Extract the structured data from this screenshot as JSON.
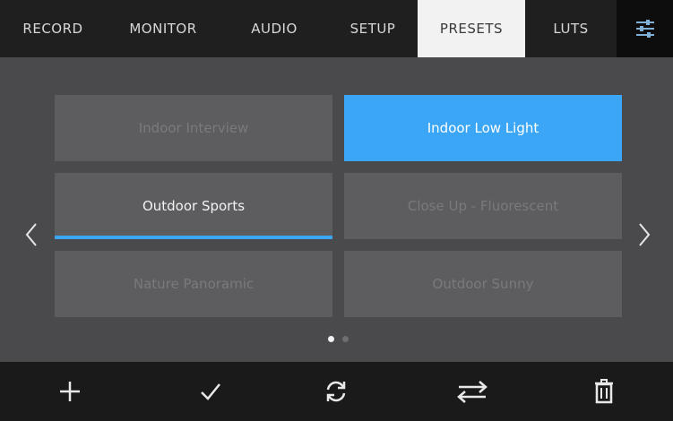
{
  "tabs": [
    {
      "label": "RECORD"
    },
    {
      "label": "MONITOR"
    },
    {
      "label": "AUDIO"
    },
    {
      "label": "SETUP"
    },
    {
      "label": "PRESETS"
    },
    {
      "label": "LUTS"
    }
  ],
  "active_tab": "PRESETS",
  "presets": [
    {
      "label": "Indoor Interview",
      "state": "inactive"
    },
    {
      "label": "Indoor Low Light",
      "state": "selected"
    },
    {
      "label": "Outdoor Sports",
      "state": "loaded"
    },
    {
      "label": "Close Up - Fluorescent",
      "state": "inactive"
    },
    {
      "label": "Nature Panoramic",
      "state": "inactive"
    },
    {
      "label": "Outdoor Sunny",
      "state": "inactive"
    }
  ],
  "pagination": {
    "current_page": 1,
    "total_pages": 2
  },
  "toolbar": {
    "icons": [
      "plus-icon",
      "checkmark-icon",
      "refresh-icon",
      "swap-arrows-icon",
      "trash-icon"
    ]
  },
  "colors": {
    "accent": "#3aa6f5",
    "tabbar": "#1f1f20",
    "background": "#4a4a4c",
    "tile": "#5d5d5f"
  }
}
